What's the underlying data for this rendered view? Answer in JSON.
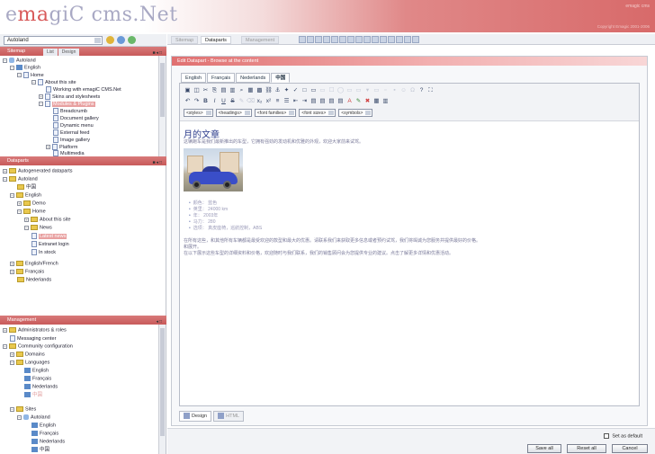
{
  "header": {
    "logo_pre": "e",
    "logo_accent": "ma",
    "logo_post": "giC cms.Net",
    "user_text": "emagic cms",
    "copyright": "Copyright Emagic 2001-2006"
  },
  "site_select": {
    "value": "Autoland"
  },
  "sitemap_panel": {
    "title": "Sitemap",
    "tabs": [
      "List",
      "Design"
    ],
    "controls": "■◂□",
    "nodes": [
      {
        "label": "Autoland"
      },
      {
        "label": "English"
      },
      {
        "label": "Home"
      },
      {
        "label": "About this site"
      },
      {
        "label": "Working with emagiC CMS.Net"
      },
      {
        "label": "Skins and stylesheets"
      },
      {
        "label": "Modules & Plugins"
      },
      {
        "label": "Breadcrumb"
      },
      {
        "label": "Document gallery"
      },
      {
        "label": "Dynamic menu"
      },
      {
        "label": "External feed"
      },
      {
        "label": "Image gallery"
      },
      {
        "label": "Platform"
      },
      {
        "label": "Multimedia"
      }
    ]
  },
  "dataparts_panel": {
    "title": "Dataparts",
    "controls": "■◂□",
    "nodes": [
      {
        "label": "Autogenerated dataparts"
      },
      {
        "label": "Autoland"
      },
      {
        "label": "中国"
      },
      {
        "label": "English"
      },
      {
        "label": "Demo"
      },
      {
        "label": "Home"
      },
      {
        "label": "About this site"
      },
      {
        "label": "News"
      },
      {
        "label": "Latest news"
      },
      {
        "label": "Extranet login"
      },
      {
        "label": "In stock"
      },
      {
        "label": "English/French"
      },
      {
        "label": "Français"
      },
      {
        "label": "Nederlands"
      }
    ]
  },
  "management_panel": {
    "title": "Management",
    "controls": "◂□",
    "nodes": [
      {
        "label": "Administrators & roles"
      },
      {
        "label": "Messaging center"
      },
      {
        "label": "Community configuration"
      },
      {
        "label": "Domains"
      },
      {
        "label": "Languages"
      },
      {
        "label": "English"
      },
      {
        "label": "Français"
      },
      {
        "label": "Nederlands"
      },
      {
        "label": "中国"
      },
      {
        "label": "Sites"
      },
      {
        "label": "Autoland"
      },
      {
        "label": "English"
      },
      {
        "label": "Français"
      },
      {
        "label": "Nederlands"
      },
      {
        "label": "中国"
      }
    ]
  },
  "main_tabs": [
    "Sitemap",
    "Dataparts",
    "Management"
  ],
  "editor": {
    "title_bar": "Edit Datapart - Browse at the content",
    "lang_tabs": [
      "English",
      "Français",
      "Nederlands",
      "中国"
    ],
    "dropdowns": [
      "<styles>",
      "<headings>",
      "<font families>",
      "<font sizes>",
      "<symbols>"
    ],
    "content_title": "月的文章",
    "intro": "这辆跑车是我们最新推出的车型，它拥有强劲的发动机和优雅的外观，欢迎大家前来试驾。",
    "bullets": [
      "颜色： 蓝色",
      "英里： 24000 km",
      "年： 2003年",
      "马力： 280",
      "选项： 真皮座椅，巡航控制，ABS"
    ],
    "para1": "在所有这些，和其他所有车辆都是最受欢迎的款型和最大的优惠。请联系我们来获取更多信息或者预约试驾，我们将竭诚为您服务并提供最好的价格。",
    "para1b": "和展开。",
    "para2": "在以下展示这些车型的详细资料和价格，欢迎随时与我们联系，我们的销售顾问会为您提供专业的建议。点击了解更多详情和优惠活动。",
    "modes": [
      "Design",
      "HTML"
    ]
  },
  "footer": {
    "set_default": "Set as default",
    "save_all": "Save all",
    "reset_all": "Reset all",
    "cancel": "Cancel"
  },
  "colors": {
    "accent": "#d86a6a",
    "folder": "#e9c84e",
    "link_blue": "#2a3a8a"
  }
}
